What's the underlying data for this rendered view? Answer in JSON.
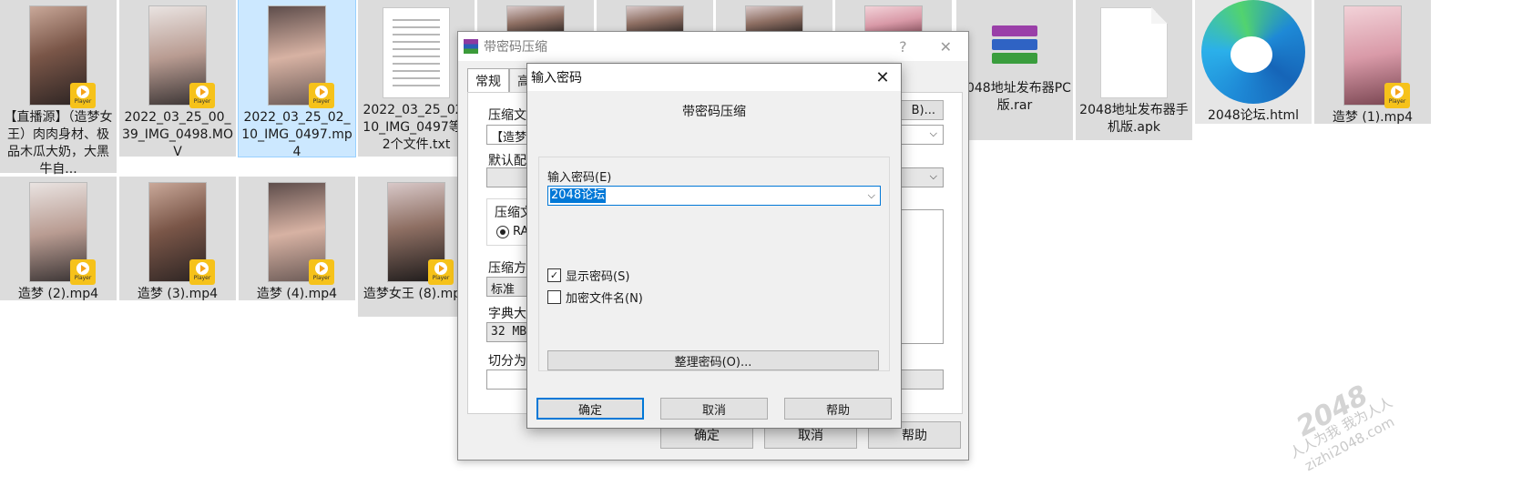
{
  "explorer": {
    "row1": [
      {
        "label": "【直播源】（造梦女王）肉肉身材、极品木瓜大奶，大黑牛自...",
        "kind": "video"
      },
      {
        "label": "2022_03_25_00_39_IMG_0498.MOV",
        "kind": "video"
      },
      {
        "label": "2022_03_25_02_10_IMG_0497.mp4",
        "kind": "video",
        "selected": true
      },
      {
        "label": "2022_03_25_02_10_IMG_0497等12个文件.txt",
        "kind": "text"
      },
      {
        "label": "",
        "kind": "video-hidden"
      },
      {
        "label": "",
        "kind": "video-hidden"
      },
      {
        "label": "",
        "kind": "video-hidden"
      },
      {
        "label": "",
        "kind": "image-hidden"
      },
      {
        "label": "2048地址发布器PC版.rar",
        "kind": "rar"
      },
      {
        "label": "2048地址发布器手机版.apk",
        "kind": "apk"
      },
      {
        "label": "2048论坛.html",
        "kind": "edge"
      },
      {
        "label": "造梦 (1).mp4",
        "kind": "video"
      }
    ],
    "row2": [
      {
        "label": "造梦 (2).mp4",
        "kind": "video"
      },
      {
        "label": "造梦 (3).mp4",
        "kind": "video"
      },
      {
        "label": "造梦 (4).mp4",
        "kind": "video"
      },
      {
        "label": "造梦女王 (8).mp4",
        "kind": "video"
      }
    ],
    "player_badge": "Player"
  },
  "back_dialog": {
    "title": "带密码压缩",
    "help_glyph": "?",
    "close_glyph": "✕",
    "tabs": [
      "常规",
      "高"
    ],
    "labels": {
      "archive_name": "压缩文",
      "default_profile": "默认配",
      "format_group": "压缩文",
      "format_rar": "RA",
      "method": "压缩方",
      "dict": "字典大",
      "split": "切分为"
    },
    "values": {
      "archive_name": "【造梦",
      "method": "标准",
      "dict": "32 MB"
    },
    "browse_button": "B)...",
    "ok": "确定",
    "cancel": "取消",
    "help": "帮助"
  },
  "front_dialog": {
    "title": "输入密码",
    "close_glyph": "✕",
    "heading": "带密码压缩",
    "password_label": "输入密码(E)",
    "password_value": "2048论坛",
    "dropdown_glyph": "⌵",
    "show_password": {
      "label": "显示密码(S)",
      "checked": true
    },
    "encrypt_names": {
      "label": "加密文件名(N)",
      "checked": false
    },
    "manage_button": "整理密码(O)...",
    "ok": "确定",
    "cancel": "取消",
    "help": "帮助"
  },
  "watermark": {
    "brand": "2048",
    "line1": "人人为我 我为人人",
    "line2": "zizhi2048.com"
  }
}
